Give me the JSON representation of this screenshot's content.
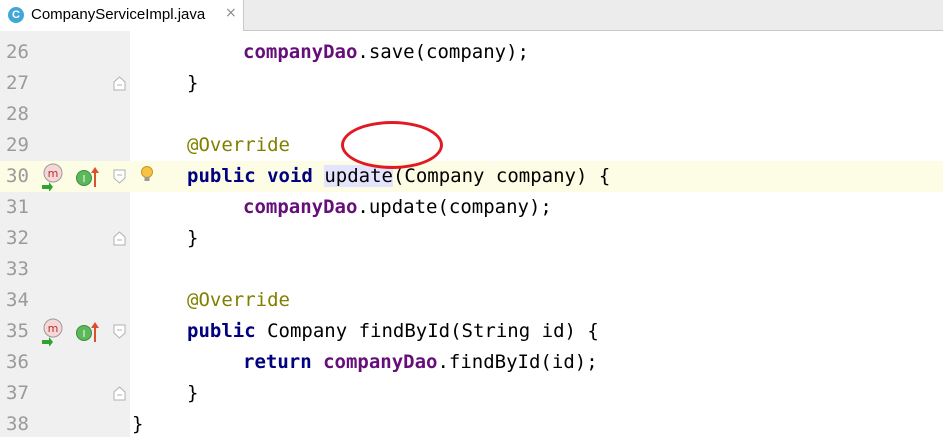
{
  "tab": {
    "icon_letter": "C",
    "title": "CompanyServiceImpl.java",
    "close": "×"
  },
  "gutter_icons": {
    "method_letter": "m",
    "impl_letter": "I"
  },
  "lines": [
    {
      "n": "26"
    },
    {
      "n": "27"
    },
    {
      "n": "28"
    },
    {
      "n": "29"
    },
    {
      "n": "30"
    },
    {
      "n": "31"
    },
    {
      "n": "32"
    },
    {
      "n": "33"
    },
    {
      "n": "34"
    },
    {
      "n": "35"
    },
    {
      "n": "36"
    },
    {
      "n": "37"
    },
    {
      "n": "38"
    }
  ],
  "code": {
    "l26": {
      "field": "companyDao",
      "rest": ".save(company);"
    },
    "l27": {
      "text": "}"
    },
    "l29": {
      "ann": "@Override"
    },
    "l30": {
      "kw1": "public",
      "kw2": "void",
      "method": "update",
      "rest": "(Company company) {"
    },
    "l31": {
      "field": "companyDao",
      "rest": ".update(company);"
    },
    "l32": {
      "text": "}"
    },
    "l34": {
      "ann": "@Override"
    },
    "l35": {
      "kw1": "public",
      "rest": "Company findById(String id) {"
    },
    "l36": {
      "kw1": "return",
      "field": "companyDao",
      "rest": ".findById(id);"
    },
    "l37": {
      "text": "}"
    },
    "l38": {
      "text": "}"
    }
  },
  "colors": {
    "keyword": "#000080",
    "field": "#660e7a",
    "annotation": "#808000",
    "highlight_circle": "#e01a22"
  }
}
